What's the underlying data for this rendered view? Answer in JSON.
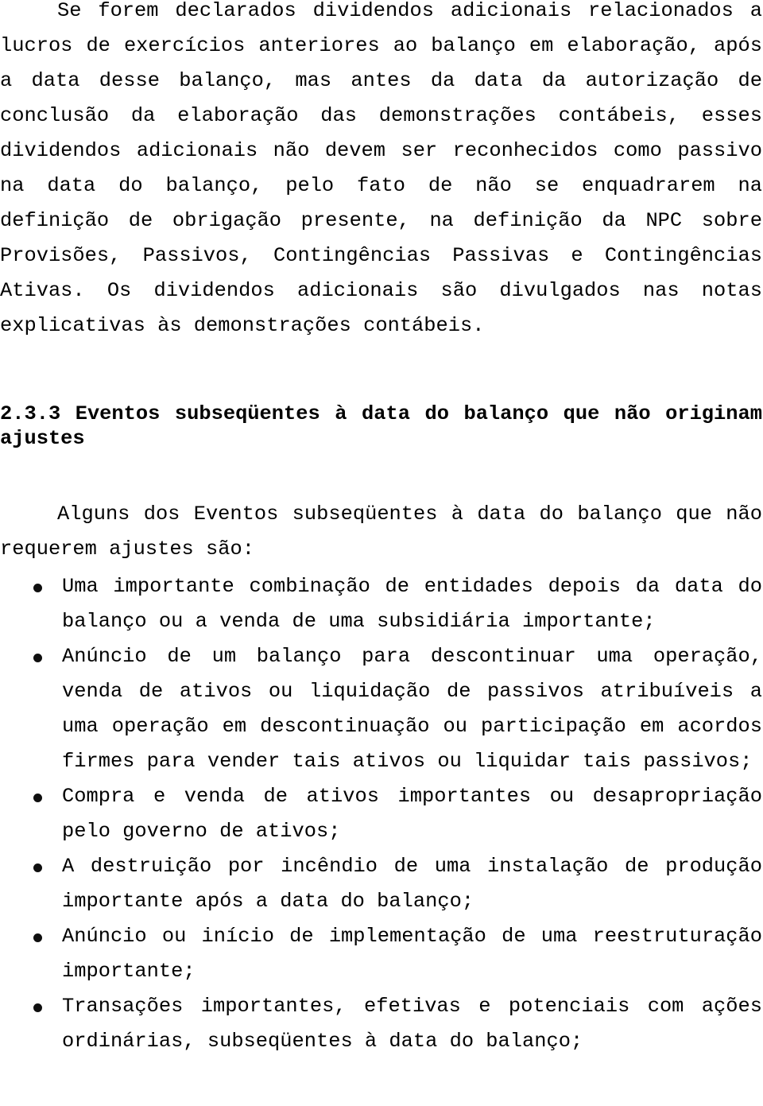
{
  "document": {
    "language": "pt-BR",
    "page_background": "#ffffff",
    "text_color": "#000000"
  },
  "paragraphs": {
    "dividends": {
      "body": "Se forem declarados dividendos adicionais relacionados a lucros de exercícios anteriores ao balanço em elaboração, após a data desse balanço, mas antes da data da autorização de conclusão da elaboração das demonstrações contábeis, esses dividendos adicionais não devem ser reconhecidos como passivo na data do balanço, pelo fato de não se enquadrarem na definição de obrigação presente, na definição da NPC sobre Provisões, Passivos, Contingências Passivas e Contingências Ativas. Os dividendos adicionais são divulgados nas notas",
      "tail": "explicativas às demonstrações contábeis."
    },
    "intro": {
      "body": "Alguns dos Eventos subseqüentes à data do balanço que não requerem ajustes são:"
    }
  },
  "heading": {
    "number": "2.3.3",
    "text": "2.3.3 Eventos subseqüentes à data do balanço que não originam ajustes"
  },
  "bullet_list": {
    "marker": "bullet-dot",
    "items": [
      {
        "text": "Uma importante combinação de entidades depois da data do balanço ou a venda de uma subsidiária importante;"
      },
      {
        "text": "Anúncio de um balanço para descontinuar uma operação, venda de ativos ou liquidação de passivos atribuíveis a uma operação em descontinuação ou participação em acordos firmes para vender tais ativos ou liquidar tais passivos;"
      },
      {
        "text": "Compra e venda de ativos importantes ou desapropriação pelo governo de ativos;"
      },
      {
        "text": "A destruição por incêndio de uma instalação de produção importante após a data do balanço;"
      },
      {
        "text": "Anúncio ou início de implementação de uma reestruturação importante;"
      },
      {
        "text": "Transações importantes, efetivas e potenciais com ações ordinárias, subseqüentes à data do balanço;"
      }
    ]
  }
}
